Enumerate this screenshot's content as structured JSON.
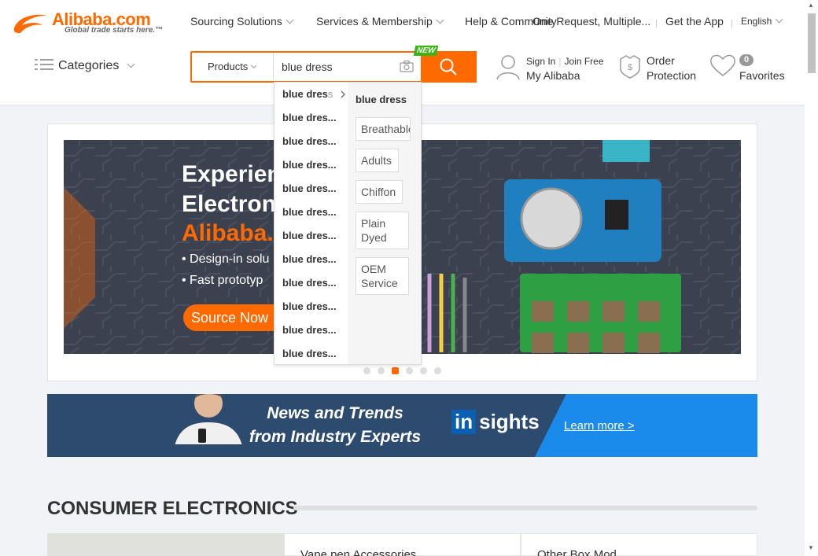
{
  "header": {
    "logo_word": "Alibaba.com",
    "logo_tagline": "Global trade starts here.™",
    "nav": [
      "Sourcing Solutions",
      "Services & Membership",
      "Help & Community"
    ],
    "rfq": "One Request, Multiple...",
    "get_app": "Get the App",
    "language": "English",
    "categories": "Categories"
  },
  "search": {
    "category": "Products",
    "value": "blue dress",
    "new_badge": "NEW"
  },
  "user": {
    "sign_in": "Sign In",
    "join": "Join Free",
    "my": "My Alibaba",
    "order_1": "Order",
    "order_2": "Protection",
    "fav_count": "0",
    "favorites": "Favorites"
  },
  "suggestions": {
    "query_bold": "blue dres",
    "items": [
      "blue dress",
      "blue dres...",
      "blue dres...",
      "blue dres...",
      "blue dres...",
      "blue dres...",
      "blue dres...",
      "blue dres...",
      "blue dres...",
      "blue dres...",
      "blue dres...",
      "blue dres..."
    ],
    "panel_title": "blue dress",
    "tags": [
      "Breathable",
      "Adults",
      "Chiffon",
      "Plain Dyed",
      "OEM Service"
    ]
  },
  "banner": {
    "line1": "Experien",
    "line2": "Electron",
    "line3": "Alibaba.",
    "bullet1": "• Design-in solu",
    "bullet2": "• Fast prototyp",
    "button": "Source Now",
    "slides_active": 3
  },
  "promo": {
    "text": "News and Trends from Industry Experts",
    "brand_a": "in",
    "brand_b": "sights",
    "learn": "Learn more >"
  },
  "section": {
    "title": "CONSUMER ELECTRONICS",
    "cards": [
      "Vape pen Accessories",
      "Other Box Mod"
    ]
  },
  "colors": {
    "accent": "#ff6a00",
    "new_badge": "#3ab512"
  }
}
